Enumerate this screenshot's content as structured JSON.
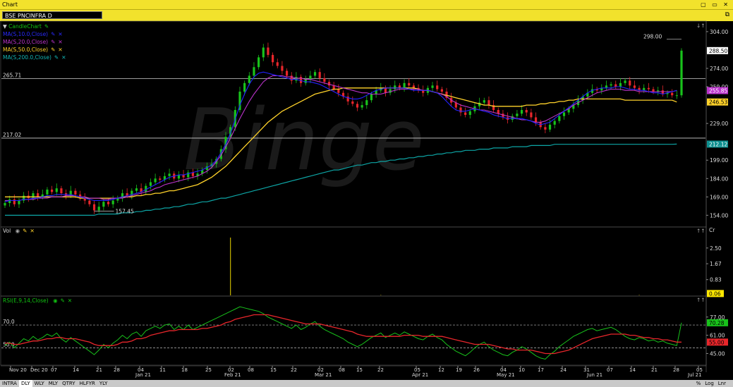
{
  "window": {
    "title": "Chart",
    "controls": "▢ ▭ ✕"
  },
  "symbol": "BSE PNCINFRA D",
  "indicators": {
    "candle": {
      "label": "CandleChart",
      "color": "#11c411"
    },
    "ma10": {
      "label": "MA(S,10.0,Close)",
      "color": "#2222ff"
    },
    "ma20": {
      "label": "MA(S,20.0,Close)",
      "color": "#bb33cc"
    },
    "ma50": {
      "label": "MA(S,50.0,Close)",
      "color": "#ffd22a"
    },
    "ma200": {
      "label": "MA(S,200.0,Close)",
      "color": "#0da5a5"
    }
  },
  "watermark": "Binge",
  "annotations": {
    "high_label": "298.00",
    "low_label": "157.45",
    "hline1": "265.71",
    "hline2": "217.02"
  },
  "price_axis": {
    "ticks": [
      "304.00",
      "274.00",
      "259.00",
      "229.00",
      "199.00",
      "184.00",
      "169.00",
      "154.00"
    ],
    "last_price": "288.50",
    "ma20_value": "255.85",
    "ma50_value": "246.53",
    "ma200_value": "212.12"
  },
  "volume_panel": {
    "label": "Vol",
    "ticks": [
      "2.50",
      "1.67",
      "0.83"
    ],
    "last": "0.06",
    "unit": "Cr"
  },
  "rsi_panel": {
    "label": "RSI(E,9,14,Close)",
    "ticks": [
      "77.00",
      "61.00",
      "45.00"
    ],
    "levels": [
      "70.0",
      "50.0"
    ],
    "rsi_value": "70.28",
    "signal_value": "55.00"
  },
  "x_axis": {
    "day_ticks": [
      "Nov 20",
      "Dec 20",
      "07",
      "14",
      "21",
      "28",
      "04",
      "11",
      "18",
      "25",
      "02",
      "08",
      "15",
      "22",
      "02",
      "08",
      "15",
      "22",
      "05",
      "12",
      "19",
      "26",
      "04",
      "10",
      "17",
      "24",
      "31",
      "07",
      "14",
      "21",
      "28",
      "05"
    ],
    "month_ticks": [
      "Jan 21",
      "Feb 21",
      "Mar 21",
      "Apr 21",
      "May 21",
      "Jun 21",
      "Jul 21"
    ]
  },
  "bottom_bar": {
    "periods": [
      "INTRA",
      "DLY",
      "WLY",
      "MLY",
      "QTRY",
      "HLFYR",
      "YLY"
    ],
    "selected": "DLY",
    "right": [
      "%",
      "Log",
      "Lnr"
    ]
  },
  "chart_data": [
    {
      "type": "candlestick",
      "title": "BSE PNCINFRA D",
      "ylim": [
        145,
        312
      ],
      "annotated_high": 298.0,
      "annotated_low": 157.45,
      "horizontal_lines": [
        265.71,
        217.02
      ],
      "close": [
        164,
        167,
        163,
        166,
        170,
        168,
        172,
        169,
        171,
        175,
        173,
        176,
        172,
        170,
        174,
        171,
        168,
        166,
        163,
        158,
        161,
        165,
        163,
        166,
        168,
        172,
        170,
        174,
        176,
        173,
        178,
        181,
        184,
        183,
        186,
        188,
        184,
        187,
        185,
        189,
        186,
        188,
        191,
        194,
        196,
        200,
        208,
        218,
        226,
        240,
        255,
        262,
        268,
        275,
        283,
        291,
        285,
        279,
        276,
        272,
        268,
        264,
        267,
        262,
        265,
        268,
        271,
        266,
        263,
        260,
        257,
        254,
        251,
        247,
        245,
        242,
        244,
        248,
        253,
        256,
        258,
        254,
        257,
        260,
        258,
        262,
        260,
        258,
        256,
        254,
        258,
        260,
        257,
        255,
        250,
        246,
        242,
        238,
        236,
        239,
        243,
        246,
        248,
        244,
        240,
        237,
        234,
        232,
        235,
        237,
        240,
        238,
        234,
        230,
        226,
        224,
        228,
        231,
        235,
        238,
        241,
        244,
        248,
        251,
        254,
        257,
        256,
        258,
        260,
        261,
        259,
        262,
        264,
        260,
        258,
        256,
        258,
        257,
        255,
        256,
        253,
        254,
        252,
        252,
        288.5
      ],
      "ma10": [
        165,
        166,
        166,
        166,
        167,
        167,
        168,
        168,
        169,
        170,
        170,
        171,
        171,
        171,
        171,
        170,
        169,
        168,
        167,
        166,
        166,
        166,
        166,
        167,
        168,
        169,
        170,
        171,
        172,
        173,
        175,
        177,
        179,
        181,
        183,
        185,
        186,
        187,
        187,
        188,
        189,
        190,
        191,
        193,
        195,
        199,
        205,
        212,
        221,
        232,
        244,
        253,
        261,
        267,
        270,
        271,
        270,
        269,
        268,
        267,
        266,
        265,
        265,
        264,
        263,
        263,
        262,
        261,
        259,
        257,
        255,
        253,
        251,
        250,
        249,
        249,
        250,
        252,
        254,
        256,
        257,
        258,
        258,
        258,
        258,
        258,
        257,
        256,
        256,
        256,
        256,
        255,
        254,
        251,
        247,
        243,
        240,
        239,
        239,
        240,
        241,
        240,
        239,
        238,
        236,
        235,
        234,
        233,
        233,
        233,
        233,
        232,
        231,
        229,
        228,
        229,
        230,
        233,
        236,
        239,
        242,
        245,
        248,
        251,
        254,
        256,
        257,
        258,
        258,
        258,
        259,
        259,
        258,
        257,
        257,
        256,
        256,
        255,
        254,
        254,
        253,
        254,
        255,
        256
      ],
      "ma20": [
        166,
        166,
        166,
        166,
        167,
        167,
        167,
        168,
        168,
        168,
        169,
        169,
        169,
        170,
        170,
        170,
        169,
        169,
        168,
        168,
        168,
        167,
        167,
        168,
        168,
        168,
        169,
        170,
        171,
        172,
        173,
        174,
        176,
        177,
        179,
        180,
        181,
        182,
        183,
        184,
        185,
        186,
        188,
        190,
        193,
        198,
        203,
        210,
        217,
        225,
        233,
        240,
        247,
        253,
        258,
        263,
        266,
        268,
        268,
        268,
        267,
        267,
        266,
        266,
        265,
        265,
        264,
        263,
        262,
        261,
        260,
        259,
        258,
        257,
        256,
        255,
        254,
        254,
        253,
        253,
        253,
        254,
        255,
        256,
        257,
        257,
        257,
        257,
        257,
        256,
        256,
        255,
        254,
        253,
        251,
        248,
        246,
        244,
        243,
        242,
        241,
        240,
        240,
        239,
        238,
        237,
        236,
        235,
        234,
        233,
        232,
        232,
        231,
        230,
        230,
        231,
        233,
        235,
        237,
        239,
        241,
        244,
        246,
        248,
        250,
        252,
        254,
        255,
        256,
        257,
        257,
        257,
        256,
        256,
        256,
        255,
        255,
        255,
        255,
        255,
        255,
        255,
        255,
        255.85
      ],
      "ma50": [
        169,
        169,
        169,
        169,
        169,
        169,
        169,
        169,
        169,
        169,
        169,
        169,
        169,
        169,
        169,
        169,
        168,
        168,
        168,
        168,
        168,
        168,
        168,
        168,
        168,
        169,
        169,
        169,
        170,
        170,
        171,
        171,
        172,
        172,
        173,
        174,
        174,
        175,
        176,
        177,
        178,
        179,
        181,
        183,
        185,
        188,
        191,
        194,
        198,
        202,
        206,
        210,
        214,
        218,
        222,
        226,
        230,
        233,
        236,
        239,
        241,
        243,
        245,
        247,
        249,
        251,
        253,
        254,
        255,
        256,
        257,
        257,
        258,
        258,
        258,
        258,
        258,
        258,
        258,
        258,
        258,
        258,
        258,
        258,
        258,
        258,
        258,
        258,
        257,
        256,
        256,
        255,
        254,
        253,
        252,
        251,
        250,
        249,
        248,
        247,
        246,
        245,
        244,
        244,
        243,
        243,
        243,
        243,
        243,
        243,
        243,
        244,
        244,
        244,
        245,
        245,
        246,
        246,
        247,
        247,
        248,
        248,
        249,
        249,
        249,
        249,
        249,
        249,
        249,
        249,
        249,
        249,
        248,
        248,
        248,
        248,
        248,
        248,
        248,
        248,
        248,
        248,
        248,
        246.53
      ],
      "ma200": [
        154,
        154,
        154,
        154,
        154,
        154,
        154,
        154,
        154,
        154,
        154,
        154,
        154,
        154,
        154,
        154,
        154,
        154,
        154,
        154,
        155,
        155,
        155,
        155,
        155,
        156,
        156,
        156,
        157,
        157,
        158,
        158,
        159,
        159,
        160,
        160,
        161,
        161,
        162,
        163,
        163,
        164,
        165,
        165,
        166,
        167,
        168,
        168,
        169,
        170,
        171,
        172,
        173,
        174,
        175,
        176,
        177,
        178,
        179,
        180,
        181,
        182,
        183,
        184,
        185,
        186,
        187,
        188,
        189,
        190,
        191,
        191,
        192,
        193,
        194,
        195,
        195,
        196,
        197,
        197,
        198,
        198,
        199,
        199,
        200,
        200,
        201,
        201,
        202,
        202,
        203,
        203,
        204,
        204,
        205,
        205,
        206,
        206,
        207,
        207,
        207,
        208,
        208,
        208,
        209,
        209,
        209,
        209,
        210,
        210,
        210,
        210,
        211,
        211,
        211,
        211,
        211,
        212,
        212,
        212,
        212,
        212,
        212,
        212,
        212,
        212,
        212,
        212,
        212,
        212,
        212,
        212,
        212,
        212,
        212,
        212,
        212,
        212,
        212,
        212,
        212,
        212,
        212,
        212.12
      ]
    },
    {
      "type": "bar",
      "title": "Vol",
      "unit": "Cr",
      "ylim": [
        0,
        3.2
      ],
      "spikes": [
        {
          "index": 48,
          "value": 3.05
        },
        {
          "index": 80,
          "value": 0.02
        },
        {
          "index": 135,
          "value": 0.02
        }
      ],
      "last": 0.06
    },
    {
      "type": "line",
      "title": "RSI(E,9,14,Close)",
      "ylim": [
        36,
        88
      ],
      "levels": [
        70,
        50
      ],
      "series": [
        {
          "name": "RSI",
          "values": [
            52,
            55,
            50,
            54,
            58,
            56,
            60,
            57,
            59,
            62,
            60,
            63,
            58,
            55,
            59,
            56,
            53,
            50,
            47,
            44,
            48,
            53,
            50,
            54,
            57,
            61,
            58,
            62,
            64,
            60,
            65,
            67,
            69,
            67,
            70,
            71,
            66,
            69,
            66,
            70,
            66,
            68,
            70,
            72,
            74,
            76,
            78,
            80,
            82,
            84,
            86,
            85,
            84,
            83,
            82,
            80,
            77,
            75,
            73,
            71,
            69,
            67,
            70,
            66,
            68,
            71,
            73,
            69,
            66,
            64,
            62,
            60,
            58,
            55,
            53,
            51,
            53,
            56,
            59,
            61,
            63,
            59,
            61,
            63,
            61,
            64,
            62,
            60,
            58,
            57,
            60,
            62,
            59,
            57,
            53,
            50,
            47,
            45,
            43,
            46,
            50,
            53,
            55,
            51,
            48,
            46,
            44,
            43,
            46,
            48,
            51,
            49,
            46,
            43,
            41,
            40,
            44,
            47,
            51,
            54,
            57,
            60,
            62,
            64,
            66,
            67,
            65,
            66,
            67,
            68,
            66,
            63,
            60,
            58,
            57,
            59,
            58,
            56,
            57,
            55,
            56,
            54,
            53,
            52,
            72
          ]
        },
        {
          "name": "Signal",
          "values": [
            54,
            54,
            53,
            53,
            54,
            55,
            56,
            56,
            57,
            58,
            58,
            59,
            59,
            58,
            58,
            58,
            57,
            56,
            55,
            53,
            52,
            52,
            52,
            52,
            53,
            55,
            55,
            56,
            58,
            58,
            59,
            61,
            62,
            63,
            64,
            65,
            65,
            66,
            66,
            66,
            66,
            66,
            67,
            67,
            68,
            69,
            70,
            72,
            73,
            75,
            76,
            77,
            78,
            79,
            79,
            79,
            79,
            78,
            77,
            76,
            75,
            74,
            73,
            72,
            71,
            71,
            71,
            71,
            70,
            69,
            68,
            67,
            66,
            65,
            64,
            62,
            61,
            60,
            60,
            60,
            60,
            60,
            60,
            60,
            60,
            61,
            61,
            61,
            61,
            60,
            60,
            60,
            60,
            60,
            59,
            58,
            57,
            56,
            55,
            54,
            53,
            53,
            53,
            53,
            52,
            51,
            50,
            49,
            49,
            48,
            48,
            48,
            48,
            47,
            46,
            45,
            45,
            45,
            46,
            47,
            48,
            50,
            52,
            54,
            56,
            58,
            59,
            60,
            61,
            62,
            62,
            62,
            62,
            61,
            61,
            60,
            59,
            59,
            58,
            58,
            57,
            57,
            56,
            55,
            55
          ]
        }
      ]
    }
  ]
}
